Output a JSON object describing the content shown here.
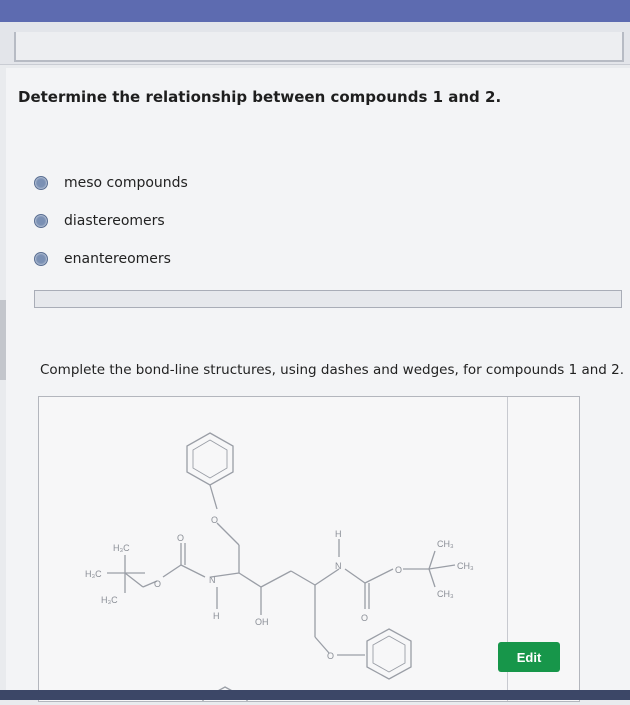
{
  "question": "Determine the relationship between compounds 1 and 2.",
  "options": [
    {
      "label": "meso compounds"
    },
    {
      "label": "diastereomers"
    },
    {
      "label": "enantereomers"
    }
  ],
  "instruction": "Complete the bond-line structures, using dashes and wedges, for compounds 1 and 2.",
  "structure_labels": {
    "o_top": "O",
    "h3c_1": "H₃C",
    "h3c_2": "H₃C",
    "h3c_3": "H₃C",
    "o_ester": "O",
    "o_carbonyl_1": "O",
    "n1": "N",
    "h_n1": "H",
    "oh": "OH",
    "h_n2": "H",
    "n2": "N",
    "o_carbonyl_2": "O",
    "o_right": "O",
    "ch3_1": "CH₃",
    "ch3_2": "CH₃",
    "ch3_3": "CH₃",
    "o_bottom": "O"
  },
  "edit_label": "Edit"
}
